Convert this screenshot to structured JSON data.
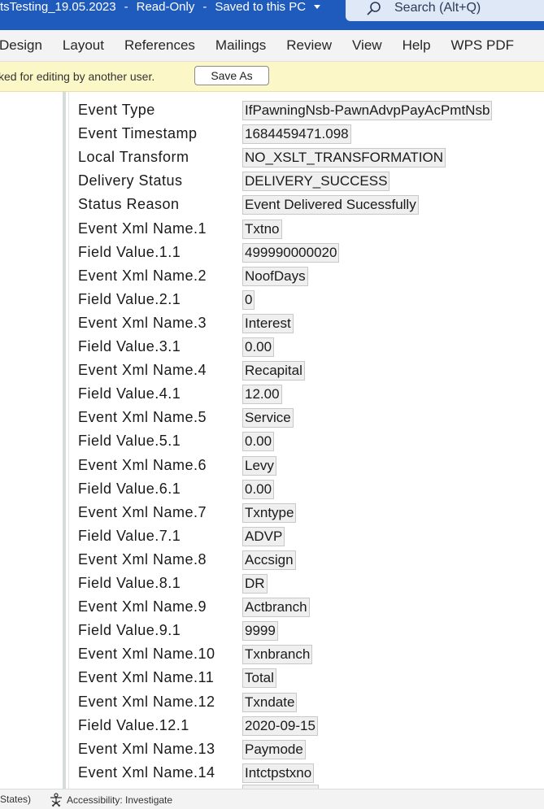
{
  "titlebar": {
    "doc_name": "tsTesting_19.05.2023",
    "status": "Read-Only",
    "saved": "Saved to this PC",
    "search_placeholder": "Search (Alt+Q)"
  },
  "ribbon": {
    "tabs": [
      "Design",
      "Layout",
      "References",
      "Mailings",
      "Review",
      "View",
      "Help",
      "WPS PDF"
    ]
  },
  "message_bar": {
    "text": "ked for editing by another user.",
    "button_label": "Save As"
  },
  "document": {
    "rows": [
      {
        "label": "Event Type",
        "value": "IfPawningNsb-PawnAdvpPayAcPmtNsb"
      },
      {
        "label": "Event Timestamp",
        "value": "1684459471.098"
      },
      {
        "label": "Local Transform",
        "value": "NO_XSLT_TRANSFORMATION"
      },
      {
        "label": "Delivery Status",
        "value": "DELIVERY_SUCCESS"
      },
      {
        "label": "Status Reason",
        "value": "Event Delivered Sucessfully"
      },
      {
        "label": "Event Xml Name.1",
        "value": "Txtno"
      },
      {
        "label": "Field Value.1.1",
        "value": "499990000020"
      },
      {
        "label": "Event Xml Name.2",
        "value": "NoofDays"
      },
      {
        "label": "Field Value.2.1",
        "value": "0"
      },
      {
        "label": "Event Xml Name.3",
        "value": "Interest"
      },
      {
        "label": "Field Value.3.1",
        "value": "0.00"
      },
      {
        "label": "Event Xml Name.4",
        "value": "Recapital"
      },
      {
        "label": "Field Value.4.1",
        "value": "12.00"
      },
      {
        "label": "Event Xml Name.5",
        "value": "Service"
      },
      {
        "label": "Field Value.5.1",
        "value": "0.00"
      },
      {
        "label": "Event Xml Name.6",
        "value": "Levy"
      },
      {
        "label": "Field Value.6.1",
        "value": "0.00"
      },
      {
        "label": "Event Xml Name.7",
        "value": "Txntype"
      },
      {
        "label": "Field Value.7.1",
        "value": "ADVP"
      },
      {
        "label": "Event Xml Name.8",
        "value": "Accsign"
      },
      {
        "label": "Field Value.8.1",
        "value": "DR"
      },
      {
        "label": "Event Xml Name.9",
        "value": "Actbranch"
      },
      {
        "label": "Field Value.9.1",
        "value": "9999"
      },
      {
        "label": "Event Xml Name.10",
        "value": "Txnbranch"
      },
      {
        "label": "Event Xml Name.11",
        "value": "Total"
      },
      {
        "label": "Event Xml Name.12",
        "value": "Txndate"
      },
      {
        "label": "Field Value.12.1",
        "value": "2020-09-15"
      },
      {
        "label": "Event Xml Name.13",
        "value": "Paymode"
      },
      {
        "label": "Event Xml Name.14",
        "value": "Intctpstxno"
      }
    ]
  },
  "statusbar": {
    "language": "States)",
    "accessibility": "Accessibility: Investigate"
  }
}
